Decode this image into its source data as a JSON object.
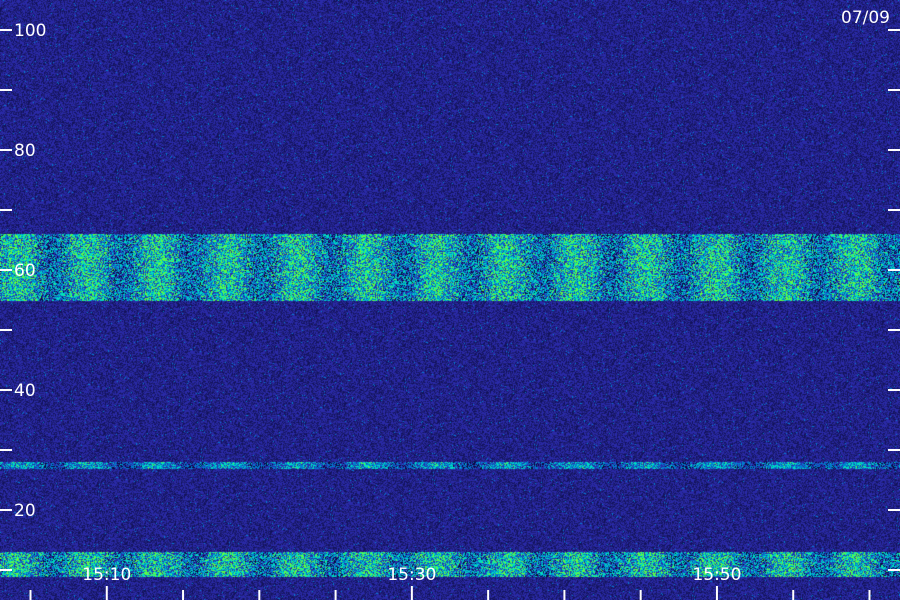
{
  "chart_data": {
    "type": "heatmap",
    "date_label": "07/09",
    "y_ticks": [
      {
        "value": 100,
        "label": "100"
      },
      {
        "value": 90,
        "label": ""
      },
      {
        "value": 80,
        "label": "80"
      },
      {
        "value": 70,
        "label": ""
      },
      {
        "value": 60,
        "label": "60"
      },
      {
        "value": 50,
        "label": ""
      },
      {
        "value": 40,
        "label": "40"
      },
      {
        "value": 30,
        "label": ""
      },
      {
        "value": 20,
        "label": "20"
      },
      {
        "value": 10,
        "label": ""
      }
    ],
    "ylim": [
      5,
      105
    ],
    "x_labels": [
      {
        "time": "15:10",
        "label": "15:10"
      },
      {
        "time": "15:30",
        "label": "15:30"
      },
      {
        "time": "15:50",
        "label": "15:50"
      }
    ],
    "x_minor_ticks": [
      "15:05",
      "15:15",
      "15:20",
      "15:25",
      "15:35",
      "15:40",
      "15:45",
      "15:55",
      "16:00"
    ],
    "xlim": [
      "15:03",
      "16:02"
    ],
    "bands": [
      {
        "from": 61,
        "to": 66,
        "intensity": "high"
      },
      {
        "from": 55,
        "to": 61,
        "intensity": "high"
      },
      {
        "from": 27,
        "to": 28,
        "intensity": "medium"
      },
      {
        "from": 9,
        "to": 13,
        "intensity": "high"
      }
    ],
    "colors": {
      "background": "#1a1a8c",
      "low": "#2a2aa8",
      "medium": "#0080d0",
      "high": "#00e0c0",
      "peak": "#60ff40"
    }
  }
}
